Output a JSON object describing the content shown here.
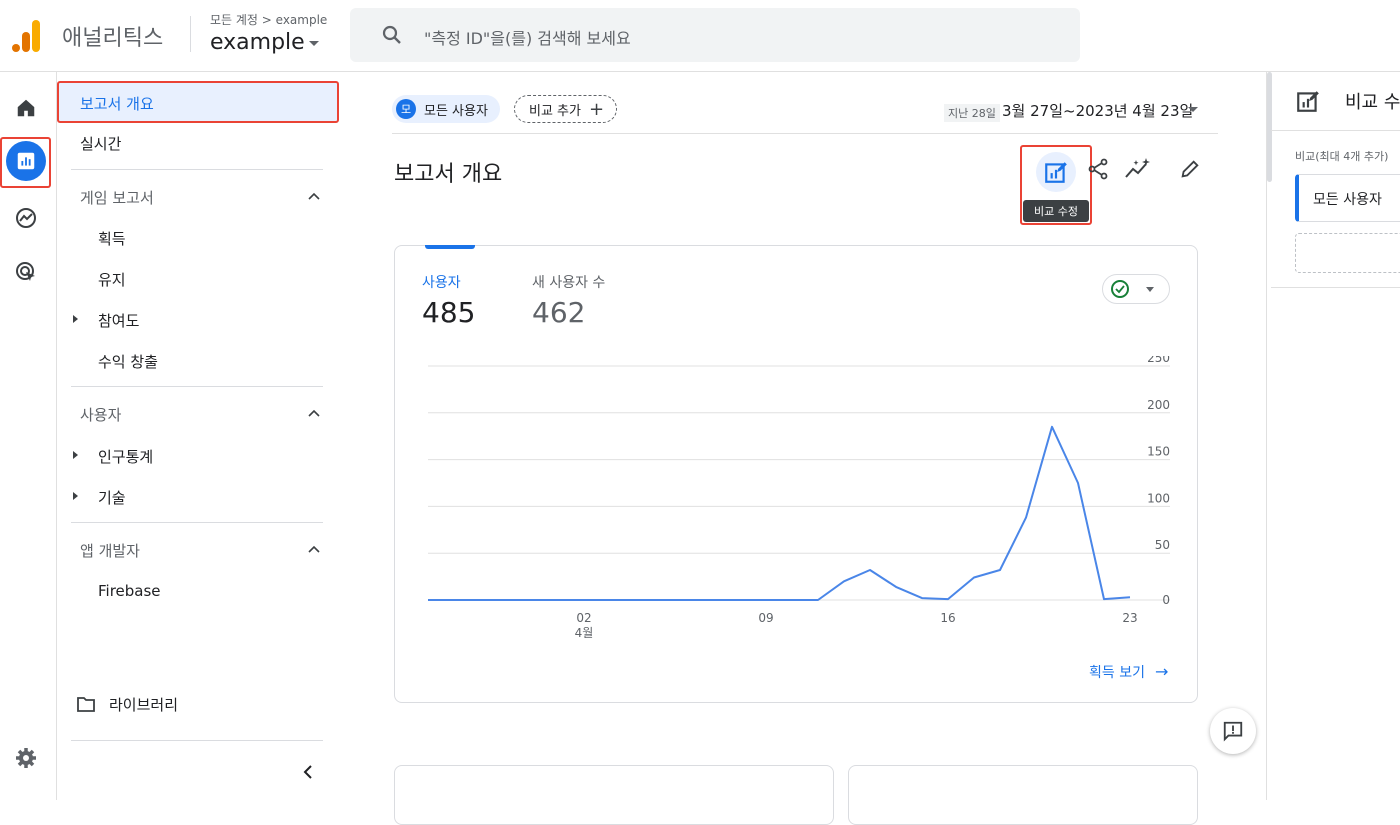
{
  "header": {
    "app_title": "애널리틱스",
    "breadcrumb": "모든 계정 > example",
    "account_name": "example",
    "search_placeholder": "\"측정 ID\"을(를) 검색해 보세요"
  },
  "nav": {
    "active": "보고서 개요",
    "realtime": "실시간",
    "section_game": "게임 보고서",
    "acquisition": "획득",
    "retention": "유지",
    "engagement": "참여도",
    "monetization": "수익 창출",
    "section_user": "사용자",
    "demographics": "인구통계",
    "tech": "기술",
    "section_dev": "앱 개발자",
    "firebase": "Firebase",
    "library": "라이브러리"
  },
  "main": {
    "chip_avatar": "모",
    "chip_user": "모든 사용자",
    "chip_add": "비교 추가",
    "date_prefix": "지난 28일",
    "date_range": "3월 27일~2023년 4월 23일",
    "page_title": "보고서 개요",
    "tooltip": "비교 수정",
    "card_link": "획득 보기"
  },
  "metrics": [
    {
      "label": "사용자",
      "value": "485",
      "color": "#1a73e8"
    },
    {
      "label": "새 사용자 수",
      "value": "462",
      "color": "#5f6368"
    }
  ],
  "chart_data": {
    "type": "line",
    "x": [
      "3/27",
      "3/28",
      "3/29",
      "3/30",
      "3/31",
      "4/1",
      "4/2",
      "4/3",
      "4/4",
      "4/5",
      "4/6",
      "4/7",
      "4/8",
      "4/9",
      "4/10",
      "4/11",
      "4/12",
      "4/13",
      "4/14",
      "4/15",
      "4/16",
      "4/17",
      "4/18",
      "4/19",
      "4/20",
      "4/21",
      "4/22",
      "4/23"
    ],
    "series": [
      {
        "values": [
          0,
          0,
          0,
          0,
          0,
          0,
          0,
          0,
          0,
          0,
          0,
          0,
          0,
          0,
          0,
          0,
          20,
          32,
          14,
          2,
          1,
          24,
          32,
          88,
          185,
          125,
          1,
          3
        ]
      }
    ],
    "x_tick_labels": [
      {
        "index": 6,
        "label": "02",
        "sub": "4월"
      },
      {
        "index": 13,
        "label": "09"
      },
      {
        "index": 20,
        "label": "16"
      },
      {
        "index": 27,
        "label": "23"
      }
    ],
    "y_ticks": [
      0,
      50,
      100,
      150,
      200,
      250
    ],
    "ylim": [
      0,
      250
    ],
    "color": "#4a86e8",
    "grid": true
  },
  "right_panel": {
    "title": "비교 수정",
    "subtitle": "비교(최대 4개 추가)",
    "item": "모든 사용자"
  },
  "colors": {
    "accent": "#1a73e8",
    "highlight": "#ea4335"
  }
}
